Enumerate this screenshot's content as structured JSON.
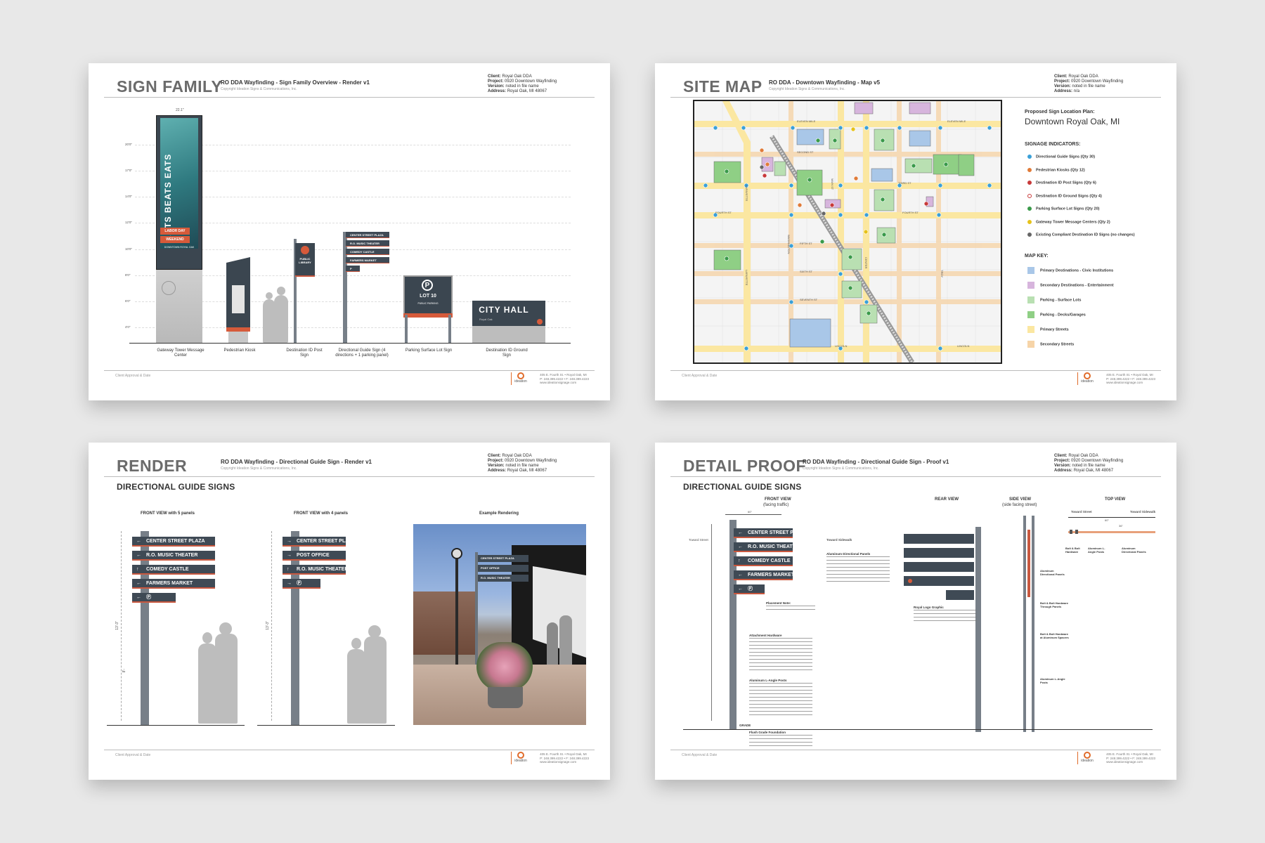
{
  "sheets": {
    "common": {
      "client_label": "Client:",
      "project_label": "Project:",
      "version_label": "Version:",
      "address_label": "Address:",
      "footer_approval": "Client Approval & Date",
      "footer_logo": "ideation",
      "footer_addr1": "405 E. Fourth St. • Royal Oak, MI",
      "footer_addr2": "P: 248.399.4222 • F: 248.399.4223",
      "footer_addr3": "www.ideationsignage.com",
      "copyright": "Copyright Ideation Signs & Communications, Inc."
    },
    "sign_family": {
      "title": "SIGN FAMILY",
      "doc": "RO DDA Wayfinding - Sign Family Overview - Render v1",
      "client": "Royal Oak DDA",
      "project": "0920 Downtown Wayfinding",
      "version": "noted in file name",
      "address": "Royal Oak, MI 48067",
      "width_dim": "22.1\"",
      "heights": [
        "20'0\"",
        "17'0\"",
        "14'0\"",
        "12'0\"",
        "10'0\"",
        "8'0\"",
        "6'0\"",
        "4'0\""
      ],
      "tower_text": "ARTS BEATS EATS",
      "tower_sub1": "LABOR DAY",
      "tower_sub2": "WEEKEND",
      "tower_sub3": "DOWNTOWN ROYAL OAK",
      "library_text": "PUBLIC LIBRARY",
      "dir_panels": [
        "CENTER STREET PLAZA",
        "R.O. MUSIC THEATER",
        "COMEDY CASTLE",
        "FARMERS MARKET",
        "P"
      ],
      "lot_text": "LOT 10",
      "lot_sub": "PUBLIC PARKING",
      "city_hall": "CITY HALL",
      "city_hall_sub": "Royal Oak",
      "labels": {
        "tower": "Gateway Tower Message Center",
        "kiosk": "Pedestrian Kiosk",
        "post": "Destination ID Post Sign",
        "dir": "Directional Guide Sign (4 directions + 1 parking panel)",
        "lot": "Parking Surface Lot Sign",
        "ground": "Destination ID Ground Sign"
      }
    },
    "site_map": {
      "title": "SITE MAP",
      "doc": "RO DDA - Downtown Wayfinding - Map v5",
      "client": "Royal Oak DDA",
      "project": "0920 Downtown Wayfinding",
      "version": "noted in file name",
      "address": "n/a",
      "plan_label": "Proposed Sign Location Plan:",
      "plan_name": "Downtown Royal Oak, MI",
      "indicators_title": "SIGNAGE INDICATORS:",
      "indicators": [
        {
          "label": "Directional Guide Signs  (Qty 30)",
          "color": "#3aa0d8",
          "fill": true
        },
        {
          "label": "Pedestrian Kiosks  (Qty 12)",
          "color": "#e07b39",
          "fill": true
        },
        {
          "label": "Destination ID Post Signs  (Qty 6)",
          "color": "#c83a3a",
          "fill": true
        },
        {
          "label": "Destination ID Ground Signs  (Qty 4)",
          "color": "#c83a3a",
          "fill": false
        },
        {
          "label": "Parking Surface Lot Signs  (Qty 20)",
          "color": "#3a9a4a",
          "fill": true
        },
        {
          "label": "Gateway Tower Message Centers  (Qty 2)",
          "color": "#e6c21a",
          "fill": true
        },
        {
          "label": "Existing Compliant Destination ID Signs (no changes)",
          "color": "#666666",
          "fill": true
        }
      ],
      "key_title": "MAP KEY:",
      "key": [
        {
          "label": "Primary Destinations - Civic Institutions",
          "color": "#a9c7e8"
        },
        {
          "label": "Secondary Destinations - Entertainment",
          "color": "#d7b5dd"
        },
        {
          "label": "Parking - Surface Lots",
          "color": "#b9e0b2"
        },
        {
          "label": "Parking - Decks/Garages",
          "color": "#8fcf85"
        },
        {
          "label": "Primary Streets",
          "color": "#fbe7a1"
        },
        {
          "label": "Secondary Streets",
          "color": "#f6d4a8"
        }
      ],
      "streets": {
        "eleven_mile": "ELEVEN MILE",
        "second": "SECOND ST",
        "third": "THIRD ST",
        "fourth": "FOURTH ST",
        "fifth": "FIFTH ST",
        "sixth": "SIXTH ST",
        "seventh": "SEVENTH ST",
        "lincoln": "LINCOLN",
        "main": "MAIN ST",
        "washington": "WASHINGTON",
        "lafayette": "LAFAYETTE",
        "troy": "TROY",
        "center": "CENTER"
      }
    },
    "render": {
      "title": "RENDER",
      "doc": "RO DDA Wayfinding - Directional Guide Sign - Render v1",
      "client": "Royal Oak DDA",
      "project": "0920 Downtown Wayfinding",
      "version": "noted in file name",
      "address": "Royal Oak, MI 48067",
      "section": "DIRECTIONAL GUIDE SIGNS",
      "view1": "FRONT VIEW with 5 panels",
      "view2": "FRONT VIEW with 4 panels",
      "view3": "Example Rendering",
      "panels5": [
        {
          "arrow": "←",
          "text": "CENTER STREET PLAZA"
        },
        {
          "arrow": "←",
          "text": "R.O. MUSIC THEATER"
        },
        {
          "arrow": "↑",
          "text": "COMEDY CASTLE"
        },
        {
          "arrow": "←",
          "text": "FARMERS MARKET"
        },
        {
          "arrow": "←",
          "text": "Ⓟ"
        }
      ],
      "panels4": [
        {
          "arrow": "→",
          "text": "CENTER STREET PLAZA"
        },
        {
          "arrow": "→",
          "text": "POST OFFICE"
        },
        {
          "arrow": "↑",
          "text": "R.O. MUSIC THEATER"
        },
        {
          "arrow": "→",
          "text": "Ⓟ"
        }
      ],
      "dim_h1": "13'-3\"",
      "dim_h2": "8'-",
      "photo_panels": [
        "CENTER STREET PLAZA",
        "POST OFFICE",
        "R.O. MUSIC THEATER"
      ]
    },
    "detail": {
      "title": "DETAIL PROOF",
      "doc": "RO DDA Wayfinding - Directional Guide Sign - Proof v1",
      "client": "Royal Oak DDA",
      "project": "0920 Downtown Wayfinding",
      "version": "noted in file name",
      "address": "Royal Oak, MI 48067",
      "section": "DIRECTIONAL GUIDE SIGNS",
      "front_view": "FRONT VIEW",
      "front_sub": "(facing traffic)",
      "rear_view": "REAR VIEW",
      "side_view": "SIDE VIEW",
      "side_sub": "(side facing street)",
      "top_view": "TOP VIEW",
      "panels": [
        {
          "arrow": "←",
          "text": "CENTER STREET PLAZA"
        },
        {
          "arrow": "←",
          "text": "R.O. MUSIC THEATER"
        },
        {
          "arrow": "↑",
          "text": "COMEDY CASTLE"
        },
        {
          "arrow": "←",
          "text": "FARMERS MARKET"
        },
        {
          "arrow": "←",
          "text": "Ⓟ"
        }
      ],
      "toward_street": "Toward Street",
      "toward_sidewalk": "Toward Sidewalk",
      "note_panels": "Aluminum Directional Panels",
      "note_parking": "Placement Note:",
      "note_attach": "Attachment Hardware",
      "note_angle": "Aluminum L-Angle Posts",
      "note_logo": "Royal Logo Graphic",
      "note_grade": "GRADE",
      "note_found": "Flush Grade Foundation",
      "side_note1": "Aluminum Directional Panels",
      "side_note2": "Bolt & Bolt Hardware Through Panels",
      "side_note3": "Bolt & Bolt Hardware at Aluminum Spacers",
      "side_note4": "Aluminum L-Angle Posts",
      "top_note1": "Bolt & Bolt Hardware",
      "top_note2": "Aluminum L-Angle Posts",
      "top_note3": "Aluminum Directional Panels",
      "dim_60": "60\"",
      "dim_36": "36\""
    }
  }
}
